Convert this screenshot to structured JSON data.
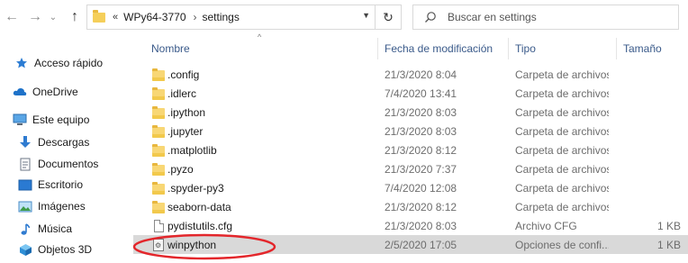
{
  "address": {
    "segments": [
      "WPy64-3770",
      "settings"
    ],
    "chevron": "«",
    "separator": "›"
  },
  "search": {
    "placeholder": "Buscar en settings"
  },
  "sidebar": {
    "items": [
      {
        "label": "Acceso rápido",
        "icon": "star-icon"
      },
      {
        "label": "OneDrive",
        "icon": "cloud-icon"
      },
      {
        "label": "Este equipo",
        "icon": "computer-icon"
      },
      {
        "label": "Descargas",
        "icon": "download-icon"
      },
      {
        "label": "Documentos",
        "icon": "document-icon"
      },
      {
        "label": "Escritorio",
        "icon": "desktop-icon"
      },
      {
        "label": "Imágenes",
        "icon": "image-icon"
      },
      {
        "label": "Música",
        "icon": "music-icon"
      },
      {
        "label": "Objetos 3D",
        "icon": "cube-icon"
      }
    ]
  },
  "columns": {
    "name": "Nombre",
    "date": "Fecha de modificación",
    "type": "Tipo",
    "size": "Tamaño"
  },
  "files": [
    {
      "name": ".config",
      "date": "21/3/2020 8:04",
      "type": "Carpeta de archivos",
      "size": "",
      "icon": "folder-icon"
    },
    {
      "name": ".idlerc",
      "date": "7/4/2020 13:41",
      "type": "Carpeta de archivos",
      "size": "",
      "icon": "folder-icon"
    },
    {
      "name": ".ipython",
      "date": "21/3/2020 8:03",
      "type": "Carpeta de archivos",
      "size": "",
      "icon": "folder-icon"
    },
    {
      "name": ".jupyter",
      "date": "21/3/2020 8:03",
      "type": "Carpeta de archivos",
      "size": "",
      "icon": "folder-icon"
    },
    {
      "name": ".matplotlib",
      "date": "21/3/2020 8:12",
      "type": "Carpeta de archivos",
      "size": "",
      "icon": "folder-icon"
    },
    {
      "name": ".pyzo",
      "date": "21/3/2020 7:37",
      "type": "Carpeta de archivos",
      "size": "",
      "icon": "folder-icon"
    },
    {
      "name": ".spyder-py3",
      "date": "7/4/2020 12:08",
      "type": "Carpeta de archivos",
      "size": "",
      "icon": "folder-icon"
    },
    {
      "name": "seaborn-data",
      "date": "21/3/2020 8:12",
      "type": "Carpeta de archivos",
      "size": "",
      "icon": "folder-icon"
    },
    {
      "name": "pydistutils.cfg",
      "date": "21/3/2020 8:03",
      "type": "Archivo CFG",
      "size": "1 KB",
      "icon": "file-icon"
    },
    {
      "name": "winpython",
      "date": "2/5/2020 17:05",
      "type": "Opciones de confi...",
      "size": "1 KB",
      "icon": "settings-file-icon",
      "selected": true
    }
  ],
  "colors": {
    "header_text": "#3a5a8a",
    "selected_row": "#d9d9d9",
    "annotation": "#e3262b"
  }
}
